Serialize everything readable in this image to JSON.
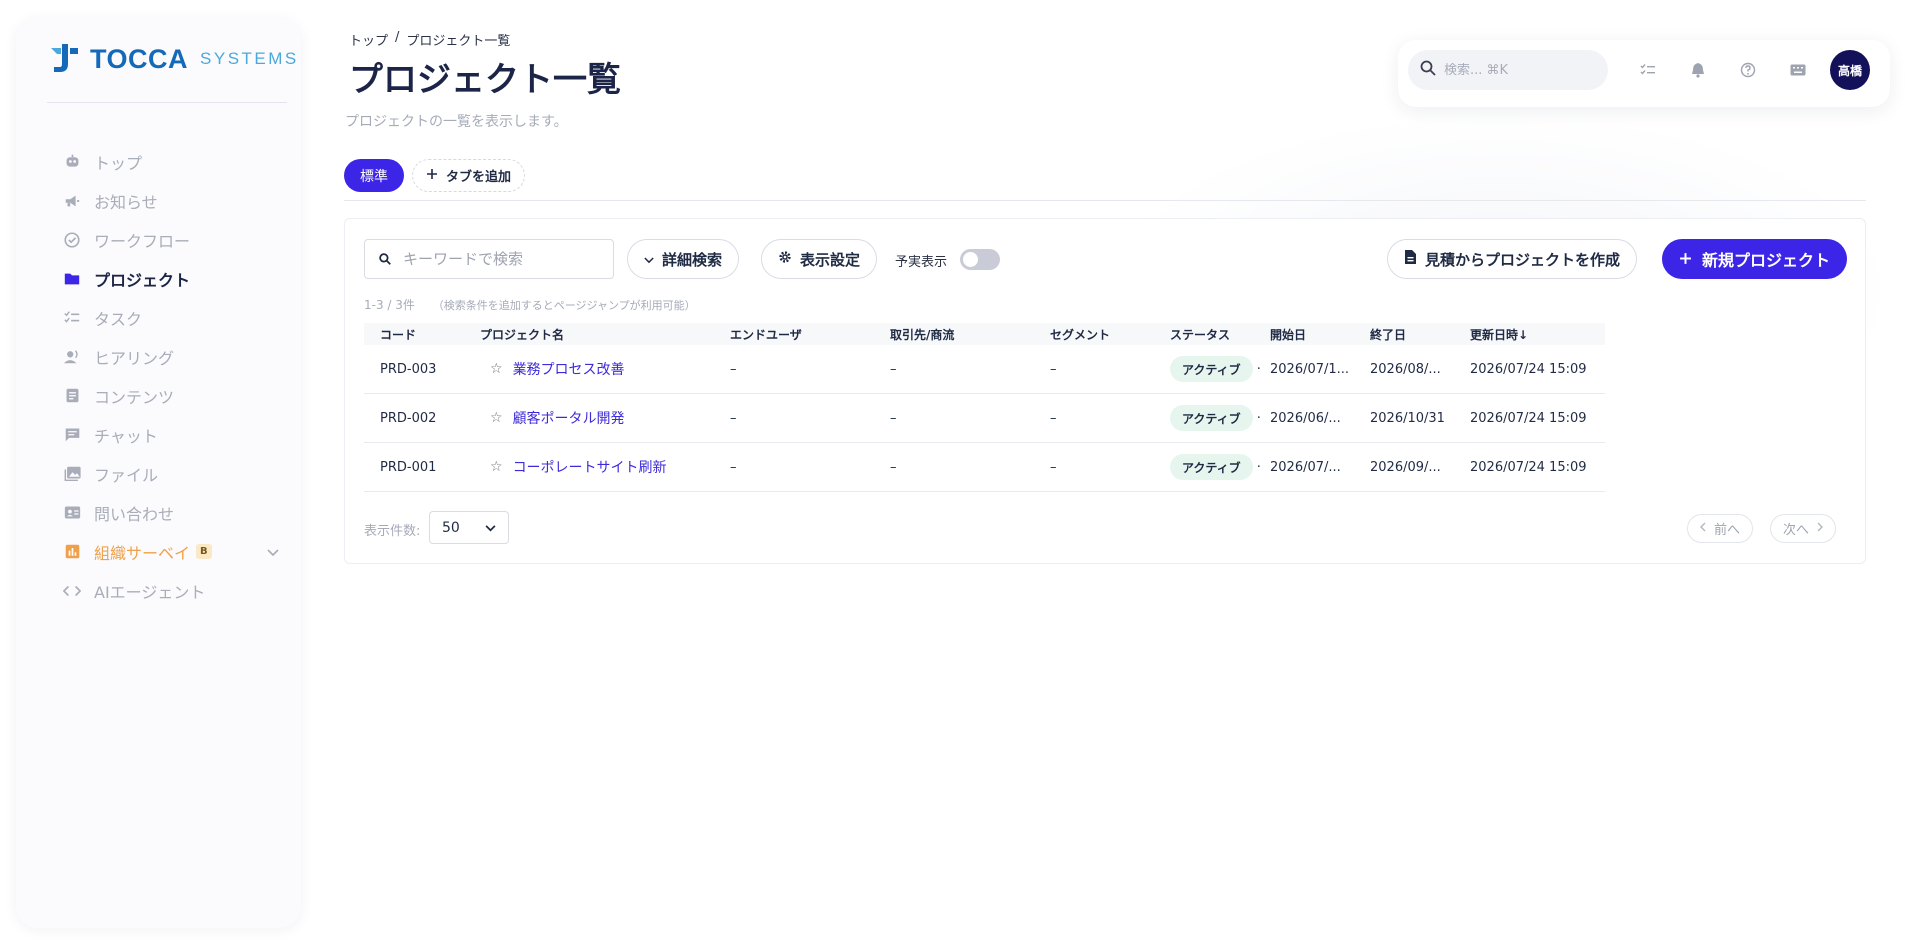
{
  "brand": {
    "name": "TOCCA",
    "sub": "SYSTEMS",
    "primary": "#1469b8",
    "accent": "#3d25e8"
  },
  "sidebar": {
    "items": [
      {
        "label": "トップ",
        "icon": "robot-icon",
        "active": false
      },
      {
        "label": "お知らせ",
        "icon": "megaphone-icon",
        "active": false
      },
      {
        "label": "ワークフロー",
        "icon": "check-circle-icon",
        "active": false
      },
      {
        "label": "プロジェクト",
        "icon": "folder-icon",
        "active": true
      },
      {
        "label": "タスク",
        "icon": "checklist-icon",
        "active": false
      },
      {
        "label": "ヒアリング",
        "icon": "person-voice-icon",
        "active": false
      },
      {
        "label": "コンテンツ",
        "icon": "document-icon",
        "active": false
      },
      {
        "label": "チャット",
        "icon": "chat-icon",
        "active": false
      },
      {
        "label": "ファイル",
        "icon": "photo-library-icon",
        "active": false
      },
      {
        "label": "問い合わせ",
        "icon": "contact-card-icon",
        "active": false
      },
      {
        "label": "組織サーベイ",
        "icon": "bar-chart-icon",
        "active": false,
        "badge": "B"
      },
      {
        "label": "AIエージェント",
        "icon": "code-icon",
        "active": false
      }
    ]
  },
  "header": {
    "breadcrumb": [
      "トップ",
      "/",
      "プロジェクト一覧"
    ],
    "title": "プロジェクト一覧",
    "subtitle": "プロジェクトの一覧を表示します。"
  },
  "topbar": {
    "search_placeholder": "検索... ⌘K",
    "avatar": "高橋"
  },
  "tabs": {
    "standard": "標準",
    "add": "タブを追加"
  },
  "toolbar": {
    "keyword_placeholder": "キーワードで検索",
    "advanced_search": "詳細検索",
    "display_settings": "表示設定",
    "toggle_label": "予実表示",
    "toggle_on": false,
    "create_from_estimate": "見積からプロジェクトを作成",
    "new_project": "新規プロジェクト"
  },
  "results": {
    "count": "1-3 / 3件",
    "hint": "（検索条件を追加するとページジャンプが利用可能）"
  },
  "table": {
    "columns": [
      "コード",
      "プロジェクト名",
      "エンドユーザ",
      "取引先/商流",
      "セグメント",
      "ステータス",
      "開始日",
      "終了日",
      "更新日時↓"
    ],
    "rows": [
      {
        "code": "PRD-003",
        "star": "☆",
        "name": "業務プロセス改善",
        "end_user": "–",
        "partner": "–",
        "segment": "–",
        "status": "アクティブ",
        "start": "2026/07/1...",
        "end": "2026/08/...",
        "updated": "2026/07/24 15:09"
      },
      {
        "code": "PRD-002",
        "star": "☆",
        "name": "顧客ポータル開発",
        "end_user": "–",
        "partner": "–",
        "segment": "–",
        "status": "アクティブ",
        "start": "2026/06/...",
        "end": "2026/10/31",
        "updated": "2026/07/24 15:09"
      },
      {
        "code": "PRD-001",
        "star": "☆",
        "name": "コーポレートサイト刷新",
        "end_user": "–",
        "partner": "–",
        "segment": "–",
        "status": "アクティブ",
        "start": "2026/07/...",
        "end": "2026/09/...",
        "updated": "2026/07/24 15:09"
      }
    ]
  },
  "footer": {
    "page_size_label": "表示件数:",
    "page_size": "50",
    "prev": "前へ",
    "next": "次へ"
  }
}
